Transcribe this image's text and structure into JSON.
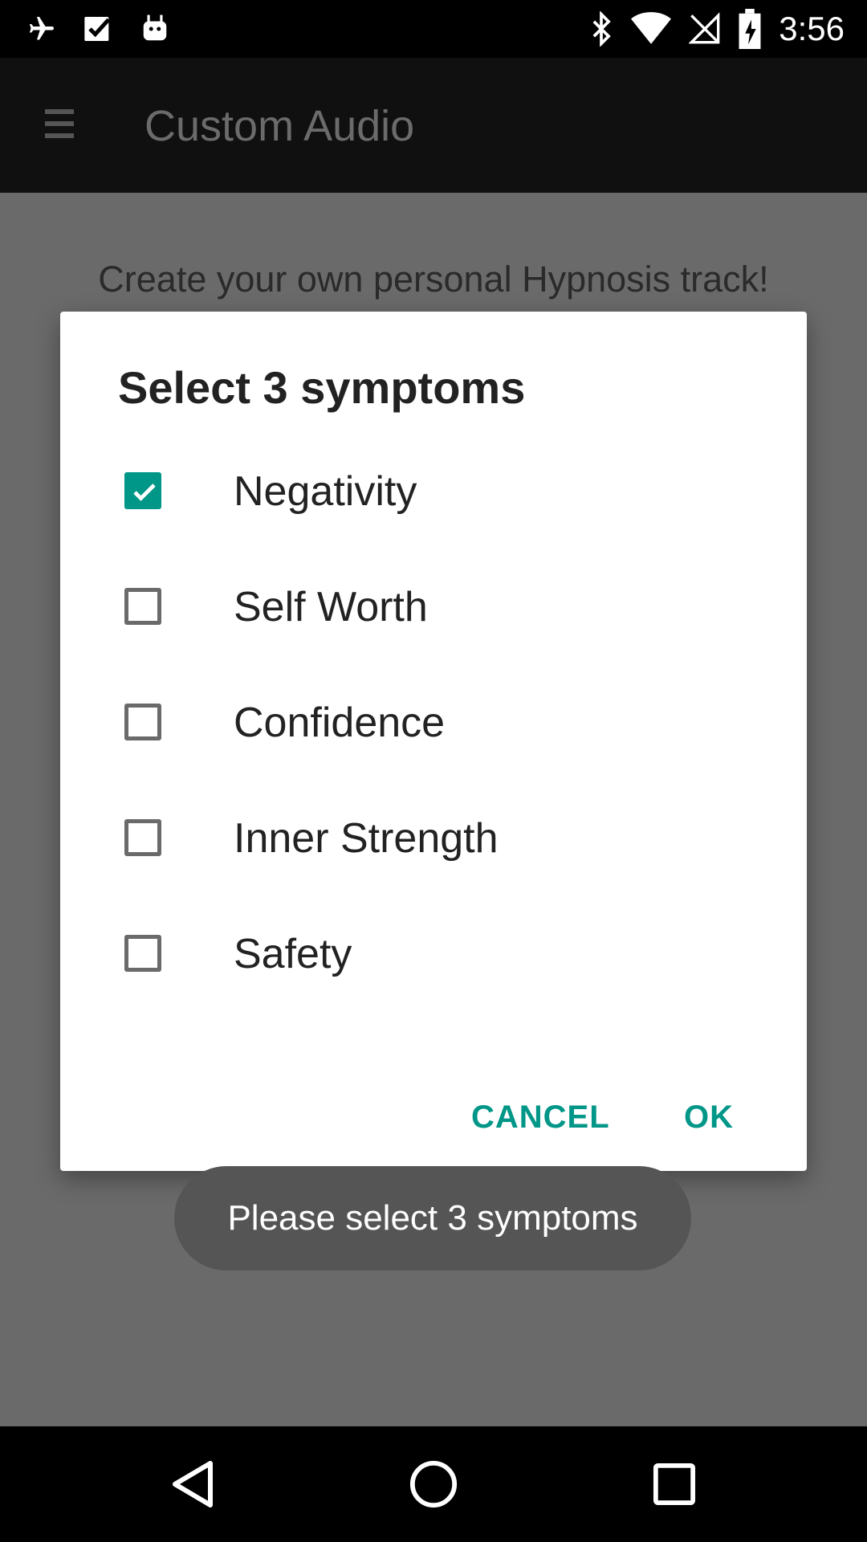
{
  "status_bar": {
    "time": "3:56",
    "icons": [
      "airplane-icon",
      "task-check-icon",
      "android-icon",
      "bluetooth-icon",
      "wifi-icon",
      "no-sim-icon",
      "battery-charging-icon"
    ]
  },
  "app_bar": {
    "menu_icon": "menu-icon",
    "title": "Custom Audio"
  },
  "content": {
    "intro": "Create your own personal Hypnosis track!"
  },
  "dialog": {
    "title": "Select 3 symptoms",
    "options": [
      {
        "label": "Negativity",
        "checked": true
      },
      {
        "label": "Self Worth",
        "checked": false
      },
      {
        "label": "Confidence",
        "checked": false
      },
      {
        "label": "Inner Strength",
        "checked": false
      },
      {
        "label": "Safety",
        "checked": false
      }
    ],
    "cancel_label": "CANCEL",
    "ok_label": "OK"
  },
  "toast": {
    "message": "Please select 3 symptoms"
  },
  "nav_bar": {
    "icons": [
      "back-icon",
      "home-icon",
      "recents-icon"
    ]
  },
  "colors": {
    "accent": "#009688",
    "scrim": "#6a6a6a"
  }
}
